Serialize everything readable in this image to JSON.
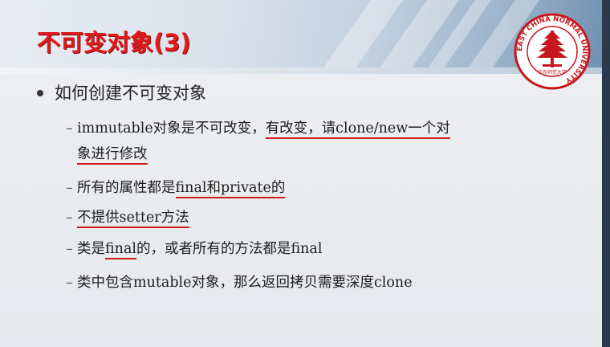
{
  "slide": {
    "title": "不可变对象(3)",
    "logo": {
      "ring_text": "EAST CHINA NORMAL UNIVERSITY",
      "seal_text": "华东师范大学",
      "color": "#c8161d"
    },
    "main_bullet": "如何创建不可变对象",
    "items": [
      {
        "pre": "immutable对象是不可改变，",
        "underlined": "有改变，请clone/new一个对",
        "line2_underlined": "象进行修改"
      },
      {
        "pre": "所有的属性都是",
        "underlined": "final和private的",
        "post": ""
      },
      {
        "pre": "",
        "underlined": "不提供setter方法",
        "post": ""
      },
      {
        "pre": "类是",
        "underlined": "final",
        "post": "的，或者所有的方法都是final"
      },
      {
        "pre": "类中包含mutable对象，那么返回拷贝需要深度clone",
        "underlined": "",
        "post": ""
      }
    ],
    "colors": {
      "title": "#e01b1b",
      "underline": "#d21818",
      "banner_blue": "#6d8fae"
    }
  }
}
